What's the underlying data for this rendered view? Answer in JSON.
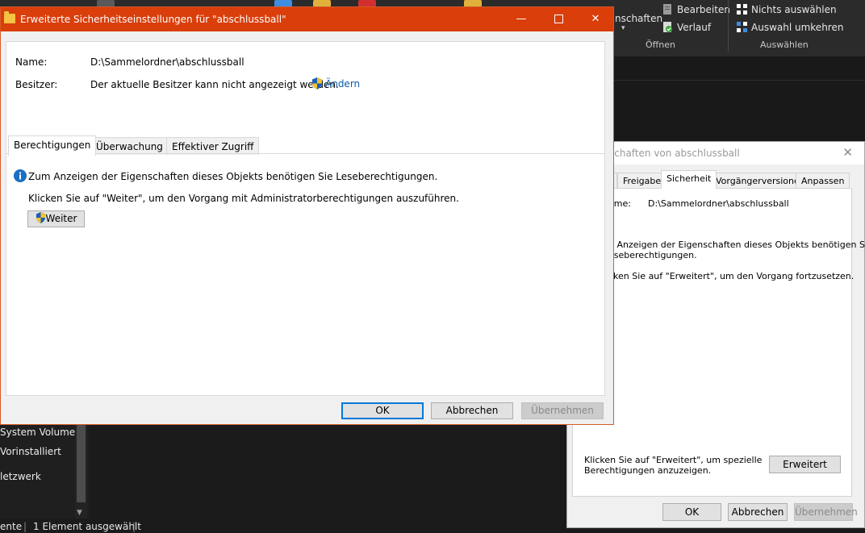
{
  "explorer": {
    "ribbon": {
      "open_partial": "nschaften",
      "edit_label": "Bearbeiten",
      "history_label": "Verlauf",
      "open_group": "Öffnen",
      "select_none": "Nichts auswählen",
      "invert_selection": "Auswahl umkehren",
      "select_group": "Auswählen"
    },
    "nav_items": [
      "System Volume Ir",
      "Vorinstalliert",
      "letzwerk"
    ],
    "status": {
      "left_partial": "ente",
      "selection": "1 Element ausgewählt"
    }
  },
  "properties": {
    "title_partial": "schaften von abschlussball",
    "tabs": [
      "Freigabe",
      "Sicherheit",
      "Vorgängerversionen",
      "Anpassen"
    ],
    "active_tab": "Sicherheit",
    "name_label": "ame:",
    "name_value": "D:\\Sammelordner\\abschlussball",
    "info_line1": "n Anzeigen der Eigenschaften dieses Objekts benötigen Sie",
    "info_line2": "eseberechtigungen.",
    "continue_text": "cken Sie auf \"Erweitert\", um den Vorgang fortzusetzen.",
    "special_line1": "Klicken Sie auf \"Erweitert\", um spezielle",
    "special_line2": "Berechtigungen anzuzeigen.",
    "advanced_button": "Erweitert",
    "ok": "OK",
    "cancel": "Abbrechen",
    "apply": "Übernehmen"
  },
  "advanced": {
    "title": "Erweiterte Sicherheitseinstellungen für \"abschlussball\"",
    "name_label": "Name:",
    "name_value": "D:\\Sammelordner\\abschlussball",
    "owner_label": "Besitzer:",
    "owner_value": "Der aktuelle Besitzer kann nicht angezeigt werden.",
    "change_link": "Ändern",
    "tabs": [
      "Berechtigungen",
      "Überwachung",
      "Effektiver Zugriff"
    ],
    "active_tab": "Berechtigungen",
    "info_text": "Zum Anzeigen der Eigenschaften dieses Objekts benötigen Sie Leseberechtigungen.",
    "continue_text": "Klicken Sie auf \"Weiter\", um den Vorgang mit Administratorberechtigungen auszuführen.",
    "continue_button": "Weiter",
    "ok": "OK",
    "cancel": "Abbrechen",
    "apply": "Übernehmen"
  },
  "colors": {
    "title_bar": "#d93e0b",
    "link": "#0a5ca8",
    "info_icon": "#1a6fc4"
  }
}
